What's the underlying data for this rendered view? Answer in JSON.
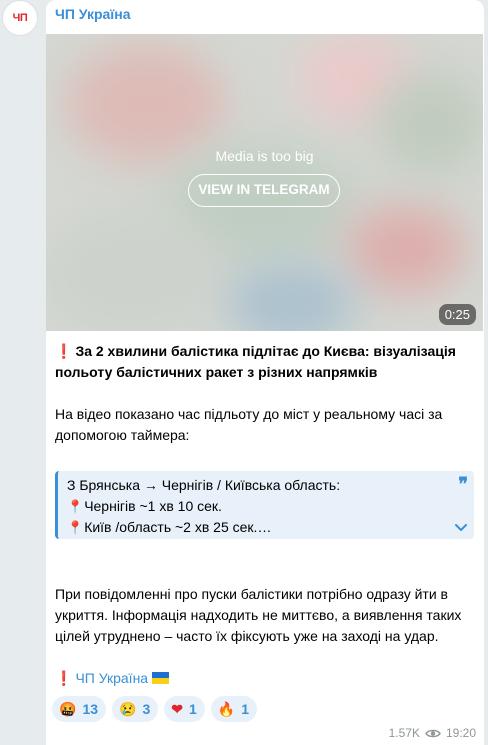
{
  "avatar": {
    "text": "ЧП"
  },
  "channel": {
    "name": "ЧП Україна"
  },
  "media": {
    "notice": "Media is too big",
    "button_label": "VIEW IN TELEGRAM",
    "duration": "0:25"
  },
  "post": {
    "title_mark": "❗",
    "title": "За 2 хвилини балістика підлітає до Києва: візуалізація польоту балістичних ракет з різних напрямків",
    "paragraph1": "На відео показано час підльоту до міст у реальному часі за допомогою таймера:",
    "quote": {
      "line1": "З Брянська → Чернігів / Київська область:",
      "line2": "Чернігів ~1 хв 10 сек.",
      "line3": "Київ /область ~2 хв 25 сек.…"
    },
    "paragraph2": "При повідомленні про пуски балістики потрібно одразу йти в укриття. Інформація надходить не миттєво, а виявлення таких цілей утруднено – часто їх фіксують уже на заході на удар.",
    "signature_mark": "❗",
    "signature": "ЧП Україна",
    "flag_colors": [
      "#1f6fd1",
      "#f7d117"
    ]
  },
  "reactions": [
    {
      "icon": "angry-face-icon",
      "emoji": "🤬",
      "count": "13"
    },
    {
      "icon": "sad-face-icon",
      "emoji": "😢",
      "count": "3"
    },
    {
      "icon": "heart-icon",
      "emoji": "❤",
      "count": "1"
    },
    {
      "icon": "fire-icon",
      "emoji": "🔥",
      "count": "1"
    }
  ],
  "meta": {
    "views": "1.57K",
    "time": "19:20"
  },
  "colors": {
    "accent": "#3a8fd6",
    "background": "#e6ebee",
    "bubble": "#ffffff",
    "alert": "#e0262b"
  }
}
